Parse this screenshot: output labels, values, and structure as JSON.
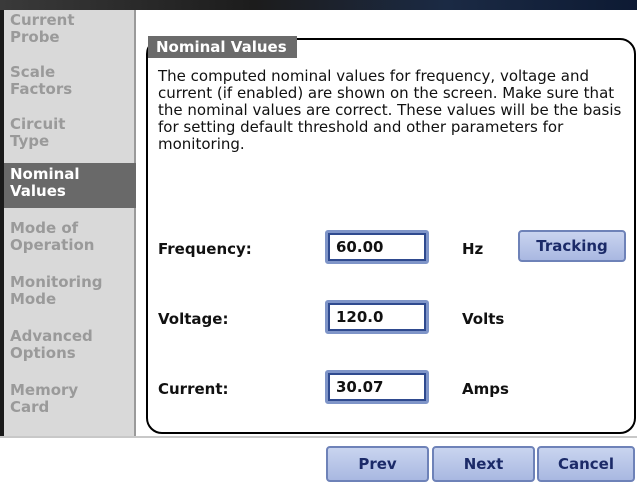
{
  "sidebar": {
    "items": [
      {
        "label": "Current\nProbe"
      },
      {
        "label": "Scale\nFactors"
      },
      {
        "label": "Circuit\nType"
      },
      {
        "label": "Nominal\nValues"
      },
      {
        "label": "Mode of\nOperation"
      },
      {
        "label": "Monitoring\nMode"
      },
      {
        "label": "Advanced\nOptions"
      },
      {
        "label": "Memory\nCard"
      }
    ]
  },
  "panel": {
    "title": "Nominal Values",
    "description": "The computed nominal values for frequency, voltage and current (if enabled) are shown on the screen. Make sure that the nominal values are correct. These values will be the basis for setting default threshold and other parameters for monitoring."
  },
  "fields": {
    "frequency": {
      "label": "Frequency:",
      "value": "60.00",
      "unit": "Hz"
    },
    "voltage": {
      "label": "Voltage:",
      "value": "120.0",
      "unit": "Volts"
    },
    "current": {
      "label": "Current:",
      "value": "30.07",
      "unit": "Amps"
    }
  },
  "tracking_label": "Tracking",
  "nav": {
    "prev": "Prev",
    "next": "Next",
    "cancel": "Cancel"
  }
}
